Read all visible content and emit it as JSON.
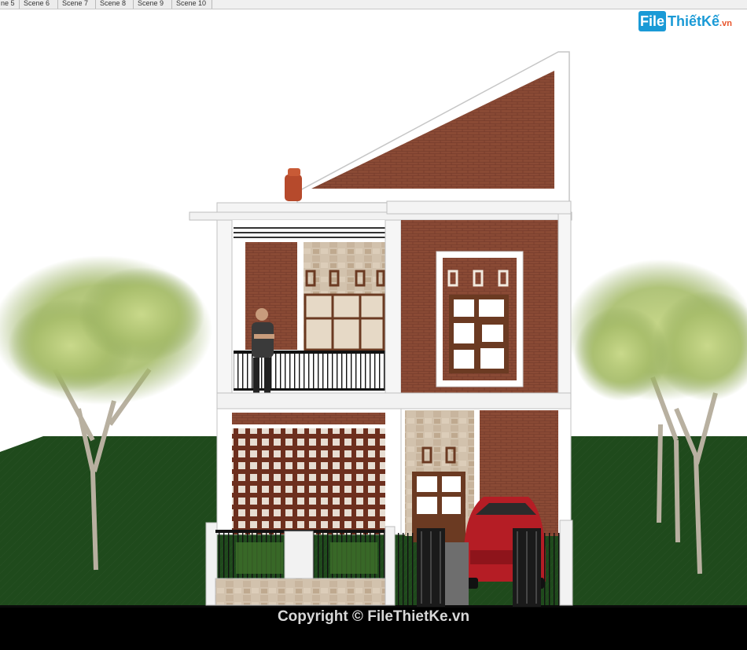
{
  "tabs": [
    "ne 5",
    "Scene 6",
    "Scene 7",
    "Scene 8",
    "Scene 9",
    "Scene 10"
  ],
  "logo": {
    "box_text": "File",
    "main_text": "ThiếtKế",
    "suffix": ".vn"
  },
  "copyright": "Copyright © FileThietKe.vn",
  "colors": {
    "brick": "#8a4a35",
    "ground": "#1f4a1c",
    "sky": "#ffffff",
    "asphalt": "#0a0a0a",
    "car": "#b51d25"
  }
}
